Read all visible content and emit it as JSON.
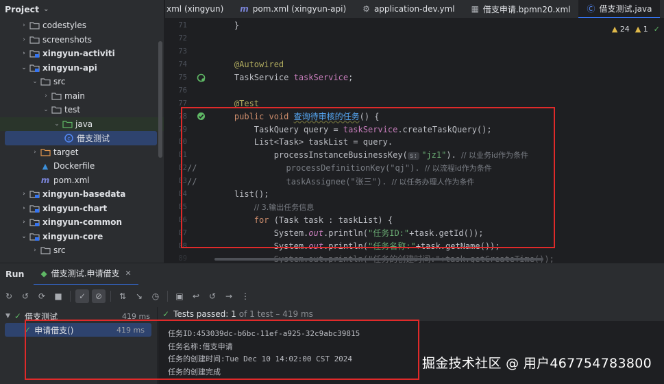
{
  "project": {
    "title": "Project",
    "tree": [
      {
        "label": "codestyles",
        "type": "folder",
        "depth": 1,
        "arrow": "right",
        "bold": false
      },
      {
        "label": "screenshots",
        "type": "folder",
        "depth": 1,
        "arrow": "right",
        "bold": false
      },
      {
        "label": "xingyun-activiti",
        "type": "module",
        "depth": 1,
        "arrow": "right",
        "bold": true
      },
      {
        "label": "xingyun-api",
        "type": "module",
        "depth": 1,
        "arrow": "down",
        "bold": true
      },
      {
        "label": "src",
        "type": "folder",
        "depth": 2,
        "arrow": "down",
        "bold": false
      },
      {
        "label": "main",
        "type": "folder",
        "depth": 3,
        "arrow": "right",
        "bold": false
      },
      {
        "label": "test",
        "type": "folder",
        "depth": 3,
        "arrow": "down",
        "bold": false
      },
      {
        "label": "java",
        "type": "test-folder",
        "depth": 4,
        "arrow": "down",
        "bold": false
      },
      {
        "label": "借支测试",
        "type": "class",
        "depth": 5,
        "arrow": "",
        "bold": false,
        "selected": true
      },
      {
        "label": "target",
        "type": "target-folder",
        "depth": 2,
        "arrow": "right",
        "bold": false
      },
      {
        "label": "Dockerfile",
        "type": "docker",
        "depth": 2,
        "arrow": "",
        "bold": false
      },
      {
        "label": "pom.xml",
        "type": "maven",
        "depth": 2,
        "arrow": "",
        "bold": false
      },
      {
        "label": "xingyun-basedata",
        "type": "module",
        "depth": 1,
        "arrow": "right",
        "bold": true
      },
      {
        "label": "xingyun-chart",
        "type": "module",
        "depth": 1,
        "arrow": "right",
        "bold": true
      },
      {
        "label": "xingyun-common",
        "type": "module",
        "depth": 1,
        "arrow": "right",
        "bold": true
      },
      {
        "label": "xingyun-core",
        "type": "module",
        "depth": 1,
        "arrow": "down",
        "bold": true
      },
      {
        "label": "src",
        "type": "folder",
        "depth": 2,
        "arrow": "right",
        "bold": false
      }
    ]
  },
  "tabs": [
    {
      "label": "xml (xingyun)",
      "icon": "",
      "active": false
    },
    {
      "label": "pom.xml (xingyun-api)",
      "icon": "maven-icon",
      "active": false
    },
    {
      "label": "application-dev.yml",
      "icon": "yaml-icon",
      "active": false
    },
    {
      "label": "借支申请.bpmn20.xml",
      "icon": "xml-icon",
      "active": false
    },
    {
      "label": "借支测试.java",
      "icon": "class-icon",
      "active": true
    }
  ],
  "inspection": {
    "warnings": "24",
    "weak_warnings": "1"
  },
  "code": {
    "line_numbers": [
      "71",
      "72",
      "73",
      "74",
      "75",
      "76",
      "77",
      "78",
      "79",
      "80",
      "81",
      "82",
      "83",
      "84",
      "85",
      "86",
      "87",
      "88",
      "89"
    ],
    "l71": "}",
    "l74": "@Autowired",
    "l75_type": "TaskService ",
    "l75_field": "taskService",
    "l75_end": ";",
    "l77": "@Test",
    "l78_kw": "public void ",
    "l78_fn": "查询待审核的任务",
    "l78_end": "() {",
    "l79_a": "TaskQuery query = ",
    "l79_field": "taskService",
    "l79_b": ".createTaskQuery();",
    "l80": "List<Task> taskList = query.",
    "l81_a": "processInstanceBusinessKey(",
    "l81_hint": "s:",
    "l81_str": "\"jz1\"",
    "l81_b": "). ",
    "l81_cmt": "// 以业务id作为条件",
    "l82_prefix": "//",
    "l82_a": "processDefinitionKey(\"qj\"). ",
    "l82_cmt": "// 以流程id作为条件",
    "l83_prefix": "//",
    "l83_a": "taskAssignee(\"张三\"). ",
    "l83_cmt": "// 以任务办理人作为条件",
    "l84": "list();",
    "l85_cmt": "// 3.输出任务信息",
    "l86_kw": "for ",
    "l86_a": "(Task task : taskList) {",
    "l87_a": "System.",
    "l87_out": "out",
    "l87_b": ".println(",
    "l87_str": "\"任务ID:\"",
    "l87_c": "+task.getId());",
    "l88_a": "System.",
    "l88_out": "out",
    "l88_b": ".println(",
    "l88_str": "\"任务名称:\"",
    "l88_c": "+task.getName());",
    "l89": "System.out.println(\"任务的创建时间:\"+task.getCreateTime());"
  },
  "run": {
    "title": "Run",
    "tab_label": "借支测试.申请借支",
    "tests": [
      {
        "label": "借支测试",
        "duration": "419 ms"
      },
      {
        "label": "申请借支()",
        "duration": "419 ms"
      }
    ],
    "status_passed": "Tests passed: 1",
    "status_detail": "of 1 test – 419 ms",
    "output": [
      "任务ID:453039dc-b6bc-11ef-a925-32c9abc39815",
      "任务名称:借支申请",
      "任务的创建时间:Tue Dec 10 14:02:00 CST 2024",
      "任务的创建完成"
    ]
  },
  "watermark": "掘金技术社区 @ 用户467754783800",
  "colors": {
    "accent": "#3574f0",
    "highlight_box": "#e02a2a",
    "pass_green": "#5fb865"
  }
}
